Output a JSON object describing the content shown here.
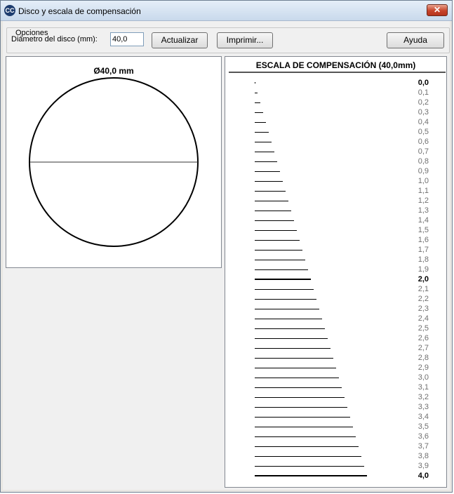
{
  "window": {
    "title": "Disco y escala de compensación",
    "icon_label": "CC"
  },
  "options": {
    "legend": "Opciones",
    "diameter_label": "Diámetro del disco (mm):",
    "diameter_value": "40,0",
    "update_label": "Actualizar",
    "print_label": "Imprimir...",
    "help_label": "Ayuda"
  },
  "disc": {
    "label": "Ø40,0 mm"
  },
  "scale": {
    "title": "ESCALA DE COMPENSACIÓN (40,0mm)",
    "entries": [
      {
        "label": "0,0",
        "value": 0.0,
        "major": true
      },
      {
        "label": "0,1",
        "value": 0.1,
        "major": false
      },
      {
        "label": "0,2",
        "value": 0.2,
        "major": false
      },
      {
        "label": "0,3",
        "value": 0.3,
        "major": false
      },
      {
        "label": "0,4",
        "value": 0.4,
        "major": false
      },
      {
        "label": "0,5",
        "value": 0.5,
        "major": false
      },
      {
        "label": "0,6",
        "value": 0.6,
        "major": false
      },
      {
        "label": "0,7",
        "value": 0.7,
        "major": false
      },
      {
        "label": "0,8",
        "value": 0.8,
        "major": false
      },
      {
        "label": "0,9",
        "value": 0.9,
        "major": false
      },
      {
        "label": "1,0",
        "value": 1.0,
        "major": false
      },
      {
        "label": "1,1",
        "value": 1.1,
        "major": false
      },
      {
        "label": "1,2",
        "value": 1.2,
        "major": false
      },
      {
        "label": "1,3",
        "value": 1.3,
        "major": false
      },
      {
        "label": "1,4",
        "value": 1.4,
        "major": false
      },
      {
        "label": "1,5",
        "value": 1.5,
        "major": false
      },
      {
        "label": "1,6",
        "value": 1.6,
        "major": false
      },
      {
        "label": "1,7",
        "value": 1.7,
        "major": false
      },
      {
        "label": "1,8",
        "value": 1.8,
        "major": false
      },
      {
        "label": "1,9",
        "value": 1.9,
        "major": false
      },
      {
        "label": "2,0",
        "value": 2.0,
        "major": true
      },
      {
        "label": "2,1",
        "value": 2.1,
        "major": false
      },
      {
        "label": "2,2",
        "value": 2.2,
        "major": false
      },
      {
        "label": "2,3",
        "value": 2.3,
        "major": false
      },
      {
        "label": "2,4",
        "value": 2.4,
        "major": false
      },
      {
        "label": "2,5",
        "value": 2.5,
        "major": false
      },
      {
        "label": "2,6",
        "value": 2.6,
        "major": false
      },
      {
        "label": "2,7",
        "value": 2.7,
        "major": false
      },
      {
        "label": "2,8",
        "value": 2.8,
        "major": false
      },
      {
        "label": "2,9",
        "value": 2.9,
        "major": false
      },
      {
        "label": "3,0",
        "value": 3.0,
        "major": false
      },
      {
        "label": "3,1",
        "value": 3.1,
        "major": false
      },
      {
        "label": "3,2",
        "value": 3.2,
        "major": false
      },
      {
        "label": "3,3",
        "value": 3.3,
        "major": false
      },
      {
        "label": "3,4",
        "value": 3.4,
        "major": false
      },
      {
        "label": "3,5",
        "value": 3.5,
        "major": false
      },
      {
        "label": "3,6",
        "value": 3.6,
        "major": false
      },
      {
        "label": "3,7",
        "value": 3.7,
        "major": false
      },
      {
        "label": "3,8",
        "value": 3.8,
        "major": false
      },
      {
        "label": "3,9",
        "value": 3.9,
        "major": false
      },
      {
        "label": "4,0",
        "value": 4.0,
        "major": true
      }
    ]
  }
}
